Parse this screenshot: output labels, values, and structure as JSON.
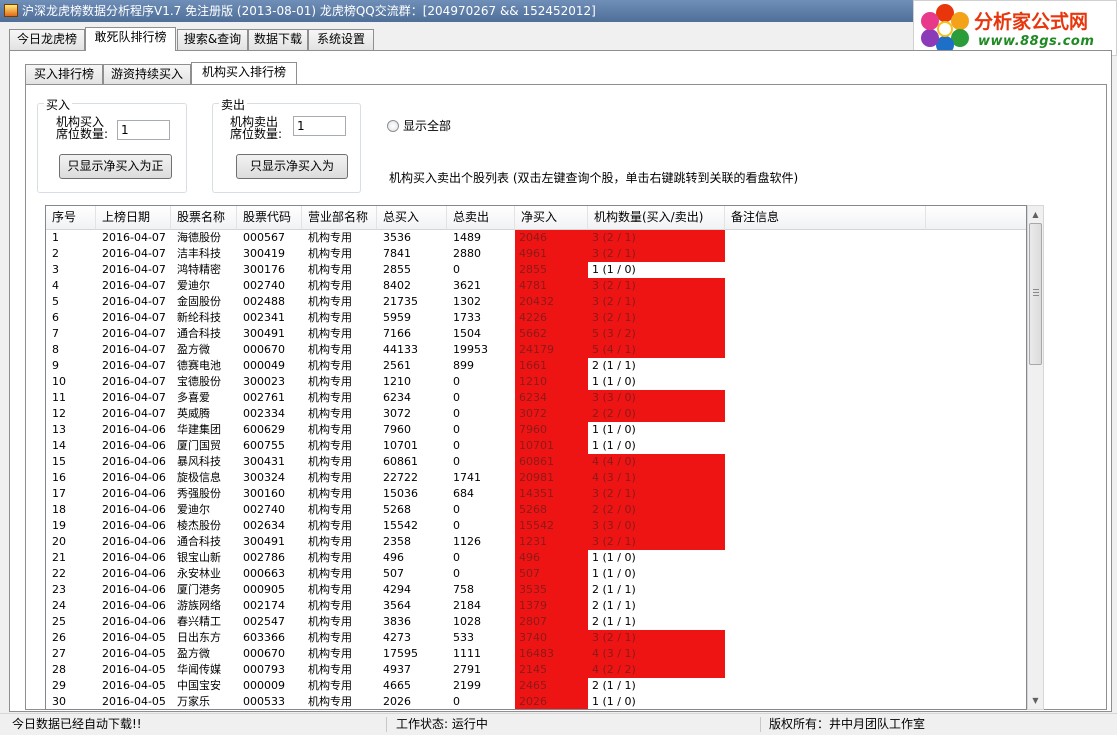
{
  "window": {
    "title": "沪深龙虎榜数据分析程序V1.7 免注册版 (2013-08-01) 龙虎榜QQ交流群：[204970267 && 152452012]"
  },
  "logo": {
    "text": "分析家公式网",
    "url": "www.88gs.com"
  },
  "main_tabs": [
    "今日龙虎榜",
    "敢死队排行榜",
    "搜索&查询",
    "数据下载",
    "系统设置"
  ],
  "main_active": 1,
  "sub_tabs": [
    "买入排行榜",
    "游资持续买入",
    "机构买入排行榜"
  ],
  "sub_active": 2,
  "buy_group": {
    "title": "买入",
    "label_line1": "机构买入",
    "label_line2": "席位数量:",
    "value": "1",
    "button": "只显示净买入为正"
  },
  "sell_group": {
    "title": "卖出",
    "label_line1": "机构卖出",
    "label_line2": "席位数量:",
    "value": "1",
    "button": "只显示净买入为"
  },
  "show_all": "显示全部",
  "list_caption": "机构买入卖出个股列表 (双击左键查询个股，单击右键跳转到关联的看盘软件)",
  "table": {
    "headers": [
      "序号",
      "上榜日期",
      "股票名称",
      "股票代码",
      "营业部名称",
      "总买入",
      "总卖出",
      "净买入",
      "机构数量(买入/卖出)",
      "备注信息"
    ],
    "rows": [
      [
        "1",
        "2016-04-07",
        "海德股份",
        "000567",
        "机构专用",
        "3536",
        "1489",
        "2046",
        "3 (2 / 1)",
        ""
      ],
      [
        "2",
        "2016-04-07",
        "洁丰科技",
        "300419",
        "机构专用",
        "7841",
        "2880",
        "4961",
        "3 (2 / 1)",
        ""
      ],
      [
        "3",
        "2016-04-07",
        "鸿特精密",
        "300176",
        "机构专用",
        "2855",
        "0",
        "2855",
        "1 (1 / 0)",
        ""
      ],
      [
        "4",
        "2016-04-07",
        "爱迪尔",
        "002740",
        "机构专用",
        "8402",
        "3621",
        "4781",
        "3 (2 / 1)",
        ""
      ],
      [
        "5",
        "2016-04-07",
        "金固股份",
        "002488",
        "机构专用",
        "21735",
        "1302",
        "20432",
        "3 (2 / 1)",
        ""
      ],
      [
        "6",
        "2016-04-07",
        "新纶科技",
        "002341",
        "机构专用",
        "5959",
        "1733",
        "4226",
        "3 (2 / 1)",
        ""
      ],
      [
        "7",
        "2016-04-07",
        "通合科技",
        "300491",
        "机构专用",
        "7166",
        "1504",
        "5662",
        "5 (3 / 2)",
        ""
      ],
      [
        "8",
        "2016-04-07",
        "盈方微",
        "000670",
        "机构专用",
        "44133",
        "19953",
        "24179",
        "5 (4 / 1)",
        ""
      ],
      [
        "9",
        "2016-04-07",
        "德赛电池",
        "000049",
        "机构专用",
        "2561",
        "899",
        "1661",
        "2 (1 / 1)",
        ""
      ],
      [
        "10",
        "2016-04-07",
        "宝德股份",
        "300023",
        "机构专用",
        "1210",
        "0",
        "1210",
        "1 (1 / 0)",
        ""
      ],
      [
        "11",
        "2016-04-07",
        "多喜爱",
        "002761",
        "机构专用",
        "6234",
        "0",
        "6234",
        "3 (3 / 0)",
        ""
      ],
      [
        "12",
        "2016-04-07",
        "英威腾",
        "002334",
        "机构专用",
        "3072",
        "0",
        "3072",
        "2 (2 / 0)",
        ""
      ],
      [
        "13",
        "2016-04-06",
        "华建集团",
        "600629",
        "机构专用",
        "7960",
        "0",
        "7960",
        "1 (1 / 0)",
        ""
      ],
      [
        "14",
        "2016-04-06",
        "厦门国贸",
        "600755",
        "机构专用",
        "10701",
        "0",
        "10701",
        "1 (1 / 0)",
        ""
      ],
      [
        "15",
        "2016-04-06",
        "暴风科技",
        "300431",
        "机构专用",
        "60861",
        "0",
        "60861",
        "4 (4 / 0)",
        ""
      ],
      [
        "16",
        "2016-04-06",
        "旋极信息",
        "300324",
        "机构专用",
        "22722",
        "1741",
        "20981",
        "4 (3 / 1)",
        ""
      ],
      [
        "17",
        "2016-04-06",
        "秀强股份",
        "300160",
        "机构专用",
        "15036",
        "684",
        "14351",
        "3 (2 / 1)",
        ""
      ],
      [
        "18",
        "2016-04-06",
        "爱迪尔",
        "002740",
        "机构专用",
        "5268",
        "0",
        "5268",
        "2 (2 / 0)",
        ""
      ],
      [
        "19",
        "2016-04-06",
        "棱杰股份",
        "002634",
        "机构专用",
        "15542",
        "0",
        "15542",
        "3 (3 / 0)",
        ""
      ],
      [
        "20",
        "2016-04-06",
        "通合科技",
        "300491",
        "机构专用",
        "2358",
        "1126",
        "1231",
        "3 (2 / 1)",
        ""
      ],
      [
        "21",
        "2016-04-06",
        "银宝山新",
        "002786",
        "机构专用",
        "496",
        "0",
        "496",
        "1 (1 / 0)",
        ""
      ],
      [
        "22",
        "2016-04-06",
        "永安林业",
        "000663",
        "机构专用",
        "507",
        "0",
        "507",
        "1 (1 / 0)",
        ""
      ],
      [
        "23",
        "2016-04-06",
        "厦门港务",
        "000905",
        "机构专用",
        "4294",
        "758",
        "3535",
        "2 (1 / 1)",
        ""
      ],
      [
        "24",
        "2016-04-06",
        "游族网络",
        "002174",
        "机构专用",
        "3564",
        "2184",
        "1379",
        "2 (1 / 1)",
        ""
      ],
      [
        "25",
        "2016-04-06",
        "春兴精工",
        "002547",
        "机构专用",
        "3836",
        "1028",
        "2807",
        "2 (1 / 1)",
        ""
      ],
      [
        "26",
        "2016-04-05",
        "日出东方",
        "603366",
        "机构专用",
        "4273",
        "533",
        "3740",
        "3 (2 / 1)",
        ""
      ],
      [
        "27",
        "2016-04-05",
        "盈方微",
        "000670",
        "机构专用",
        "17595",
        "1111",
        "16483",
        "4 (3 / 1)",
        ""
      ],
      [
        "28",
        "2016-04-05",
        "华闻传媒",
        "000793",
        "机构专用",
        "4937",
        "2791",
        "2145",
        "4 (2 / 2)",
        ""
      ],
      [
        "29",
        "2016-04-05",
        "中国宝安",
        "000009",
        "机构专用",
        "4665",
        "2199",
        "2465",
        "2 (1 / 1)",
        ""
      ],
      [
        "30",
        "2016-04-05",
        "万家乐",
        "000533",
        "机构专用",
        "2026",
        "0",
        "2026",
        "1 (1 / 0)",
        ""
      ]
    ],
    "highlight_rows_count_col": [
      1,
      2,
      4,
      5,
      6,
      7,
      8,
      11,
      12,
      15,
      16,
      17,
      18,
      19,
      20,
      26,
      27,
      28
    ]
  },
  "status": {
    "left": "今日数据已经自动下载!!",
    "middle": "工作状态: 运行中",
    "right": "版权所有：井中月团队工作室"
  },
  "colors": {
    "highlight": "#ee1414",
    "titlebar": "#5a7aa5"
  }
}
